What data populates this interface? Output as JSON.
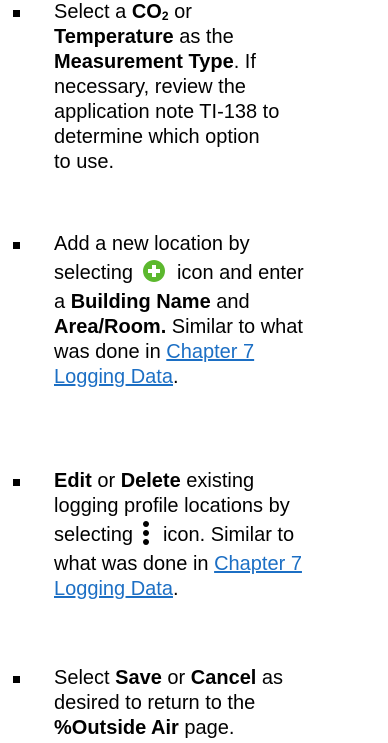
{
  "items": [
    {
      "t1": "Select a ",
      "co2": "CO",
      "co2_sub": "2",
      "t2": " or",
      "temperature": "Temperature",
      "t3": " as the",
      "measurement_type": "Measurement Type",
      "t4": ". If",
      "l4": "necessary, review the",
      "l5": "application note TI-138 to",
      "l6": "determine which option",
      "l7": "to use."
    },
    {
      "l1": "Add a new location by",
      "t2": "selecting",
      "t3": "icon and enter",
      "t4": "a ",
      "building_name": "Building Name",
      "t5": " and",
      "area_room": "Area/Room.",
      "t6": " Similar to what",
      "t7": "was done in ",
      "link_part1": "Chapter 7",
      "link_part2": "Logging Data",
      "t8": "."
    },
    {
      "edit": "Edit",
      "t1": " or ",
      "delete": "Delete",
      "t2": " existing",
      "l2": "logging profile locations by",
      "t3": "selecting",
      "t4": "icon. Similar to",
      "t5": "what was done in ",
      "link_part1": "Chapter 7",
      "link_part2": "Logging Data",
      "t6": "."
    },
    {
      "t1": "Select ",
      "save": "Save",
      "t2": " or ",
      "cancel": "Cancel",
      "t3": " as",
      "l2": "desired to return to the",
      "outside_air": "%Outside Air",
      "t4": " page."
    }
  ]
}
